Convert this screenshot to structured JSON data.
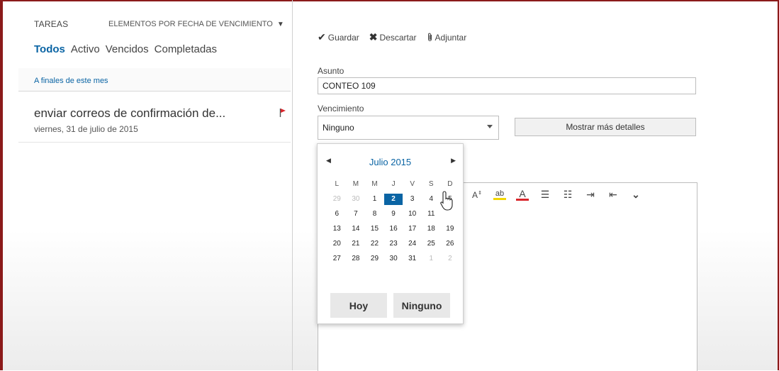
{
  "list": {
    "title": "TAREAS",
    "filter": "ELEMENTOS POR FECHA DE VENCIMIENTO",
    "tabs": [
      {
        "label": "Todos",
        "active": true
      },
      {
        "label": "Activo",
        "active": false
      },
      {
        "label": "Vencidos",
        "active": false
      },
      {
        "label": "Completadas",
        "active": false
      }
    ],
    "group": "A finales de este mes",
    "tasks": [
      {
        "subject": "enviar correos de confirmación de...",
        "due": "viernes, 31 de julio de 2015"
      }
    ]
  },
  "toolbar": {
    "save": "Guardar",
    "discard": "Descartar",
    "attach": "Adjuntar"
  },
  "form": {
    "subject_label": "Asunto",
    "subject_value": "CONTEO 109",
    "due_label": "Vencimiento",
    "due_value": "Ninguno",
    "more_details": "Mostrar más detalles"
  },
  "calendar": {
    "month": "Julio 2015",
    "day_names": [
      "L",
      "M",
      "M",
      "J",
      "V",
      "S",
      "D"
    ],
    "weeks": [
      [
        "29",
        "30",
        "1",
        "2",
        "3",
        "4",
        "5"
      ],
      [
        "6",
        "7",
        "8",
        "9",
        "10",
        "11",
        ""
      ],
      [
        "13",
        "14",
        "15",
        "16",
        "17",
        "18",
        "19"
      ],
      [
        "20",
        "21",
        "22",
        "23",
        "24",
        "25",
        "26"
      ],
      [
        "27",
        "28",
        "29",
        "30",
        "31",
        "1",
        "2"
      ]
    ],
    "selected": "2",
    "today_button": "Hoy",
    "none_button": "Ninguno"
  },
  "colors": {
    "accent": "#0a64a4",
    "flag": "#d9262c",
    "frame": "#8b1a1a"
  }
}
